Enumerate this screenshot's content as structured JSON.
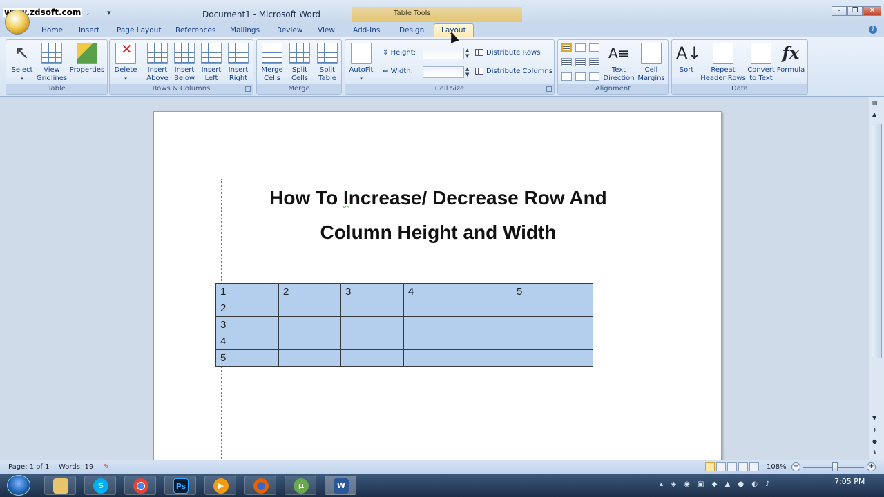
{
  "watermark": "www.zdsoft.com",
  "window_title": "Document1 - Microsoft Word",
  "context_title": "Table Tools",
  "tabs": [
    {
      "label": "Home"
    },
    {
      "label": "Insert"
    },
    {
      "label": "Page Layout"
    },
    {
      "label": "References"
    },
    {
      "label": "Mailings"
    },
    {
      "label": "Review"
    },
    {
      "label": "View"
    },
    {
      "label": "Add-Ins"
    },
    {
      "label": "Design"
    },
    {
      "label": "Layout"
    }
  ],
  "ribbon": {
    "table": {
      "label": "Table",
      "select": "Select",
      "view": "View",
      "gridlines": "Gridlines",
      "properties": "Properties"
    },
    "rows_cols": {
      "label": "Rows & Columns",
      "delete": "Delete",
      "insert": "Insert",
      "above": "Above",
      "below": "Below",
      "left": "Left",
      "right": "Right"
    },
    "merge": {
      "label": "Merge",
      "merge": "Merge",
      "cells": "Cells",
      "split": "Split",
      "table": "Table"
    },
    "cell_size": {
      "label": "Cell Size",
      "autofit": "AutoFit",
      "height": "Height:",
      "width": "Width:",
      "dist_rows": "Distribute Rows",
      "dist_cols": "Distribute Columns"
    },
    "alignment": {
      "label": "Alignment",
      "text": "Text",
      "direction": "Direction",
      "cell": "Cell",
      "margins": "Margins"
    },
    "data": {
      "label": "Data",
      "sort": "Sort",
      "repeat": "Repeat",
      "header_rows": "Header Rows",
      "convert": "Convert",
      "to_text": "to Text",
      "formula": "Formula"
    }
  },
  "document": {
    "title_part1": "How To ",
    "title_squiggle": "I",
    "title_part2": "ncrease/ Decrease Row And",
    "title_line2": "Column Height and Width",
    "table": [
      [
        "1",
        "2",
        "3",
        "4",
        "5"
      ],
      [
        "2",
        "",
        "",
        "",
        ""
      ],
      [
        "3",
        "",
        "",
        "",
        ""
      ],
      [
        "4",
        "",
        "",
        "",
        ""
      ],
      [
        "5",
        "",
        "",
        "",
        ""
      ]
    ]
  },
  "status": {
    "page": "Page: 1 of 1",
    "words": "Words: 19",
    "zoom": "108%"
  },
  "taskbar": {
    "clock": "7:05 PM"
  }
}
